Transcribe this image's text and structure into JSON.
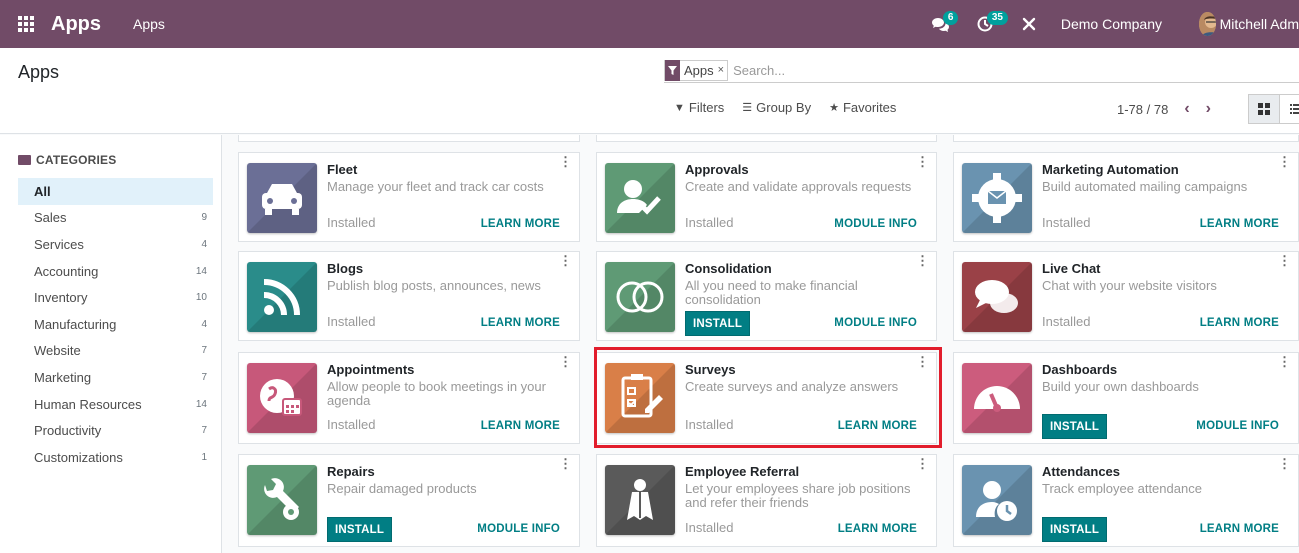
{
  "navbar": {
    "brand": "Apps",
    "menu": "Apps",
    "messages_badge": "6",
    "activity_badge": "35",
    "company": "Demo Company",
    "user": "Mitchell Adm"
  },
  "control": {
    "title": "Apps",
    "facet_label": "Apps",
    "facet_close": "×",
    "search_placeholder": "Search...",
    "filters_label": "Filters",
    "groupby_label": "Group By",
    "favorites_label": "Favorites",
    "pager": "1-78 / 78"
  },
  "sidebar": {
    "heading": "CATEGORIES",
    "items": [
      {
        "label": "All",
        "count": ""
      },
      {
        "label": "Sales",
        "count": "9"
      },
      {
        "label": "Services",
        "count": "4"
      },
      {
        "label": "Accounting",
        "count": "14"
      },
      {
        "label": "Inventory",
        "count": "10"
      },
      {
        "label": "Manufacturing",
        "count": "4"
      },
      {
        "label": "Website",
        "count": "7"
      },
      {
        "label": "Marketing",
        "count": "7"
      },
      {
        "label": "Human Resources",
        "count": "14"
      },
      {
        "label": "Productivity",
        "count": "7"
      },
      {
        "label": "Customizations",
        "count": "1"
      }
    ]
  },
  "cards": [
    {
      "name": "Fleet",
      "desc": "Manage your fleet and track car costs",
      "status": "Installed",
      "link": "LEARN MORE",
      "icon": "car-icon",
      "color": "#6b6f96"
    },
    {
      "name": "Approvals",
      "desc": "Create and validate approvals requests",
      "status": "Installed",
      "link": "MODULE INFO",
      "icon": "user-check-icon",
      "color": "#5f9a75"
    },
    {
      "name": "Marketing Automation",
      "desc": "Build automated mailing campaigns",
      "status": "Installed",
      "link": "LEARN MORE",
      "icon": "gear-mail-icon",
      "color": "#6a93b0"
    },
    {
      "name": "Blogs",
      "desc": "Publish blog posts, announces, news",
      "status": "Installed",
      "link": "LEARN MORE",
      "icon": "rss-icon",
      "color": "#2a8c8a"
    },
    {
      "name": "Consolidation",
      "desc": "All you need to make financial consolidation",
      "install": "INSTALL",
      "link": "MODULE INFO",
      "icon": "venn-icon",
      "color": "#5f9a75"
    },
    {
      "name": "Live Chat",
      "desc": "Chat with your website visitors",
      "status": "Installed",
      "link": "LEARN MORE",
      "icon": "chat-icon",
      "color": "#9a4147"
    },
    {
      "name": "Appointments",
      "desc": "Allow people to book meetings in your agenda",
      "status": "Installed",
      "link": "LEARN MORE",
      "icon": "globe-calendar-icon",
      "color": "#c7587a"
    },
    {
      "name": "Surveys",
      "desc": "Create surveys and analyze answers",
      "status": "Installed",
      "link": "LEARN MORE",
      "icon": "survey-icon",
      "color": "#d97f48"
    },
    {
      "name": "Dashboards",
      "desc": "Build your own dashboards",
      "install": "INSTALL",
      "link": "MODULE INFO",
      "icon": "gauge-icon",
      "color": "#cc5c7d"
    },
    {
      "name": "Repairs",
      "desc": "Repair damaged products",
      "install": "INSTALL",
      "link": "MODULE INFO",
      "icon": "wrench-icon",
      "color": "#5f9a75"
    },
    {
      "name": "Employee Referral",
      "desc": "Let your employees share job positions and refer their friends",
      "status": "Installed",
      "link": "LEARN MORE",
      "icon": "referral-icon",
      "color": "#5a5a5a"
    },
    {
      "name": "Attendances",
      "desc": "Track employee attendance",
      "install": "INSTALL",
      "link": "LEARN MORE",
      "icon": "user-clock-icon",
      "color": "#6a93b0"
    }
  ]
}
